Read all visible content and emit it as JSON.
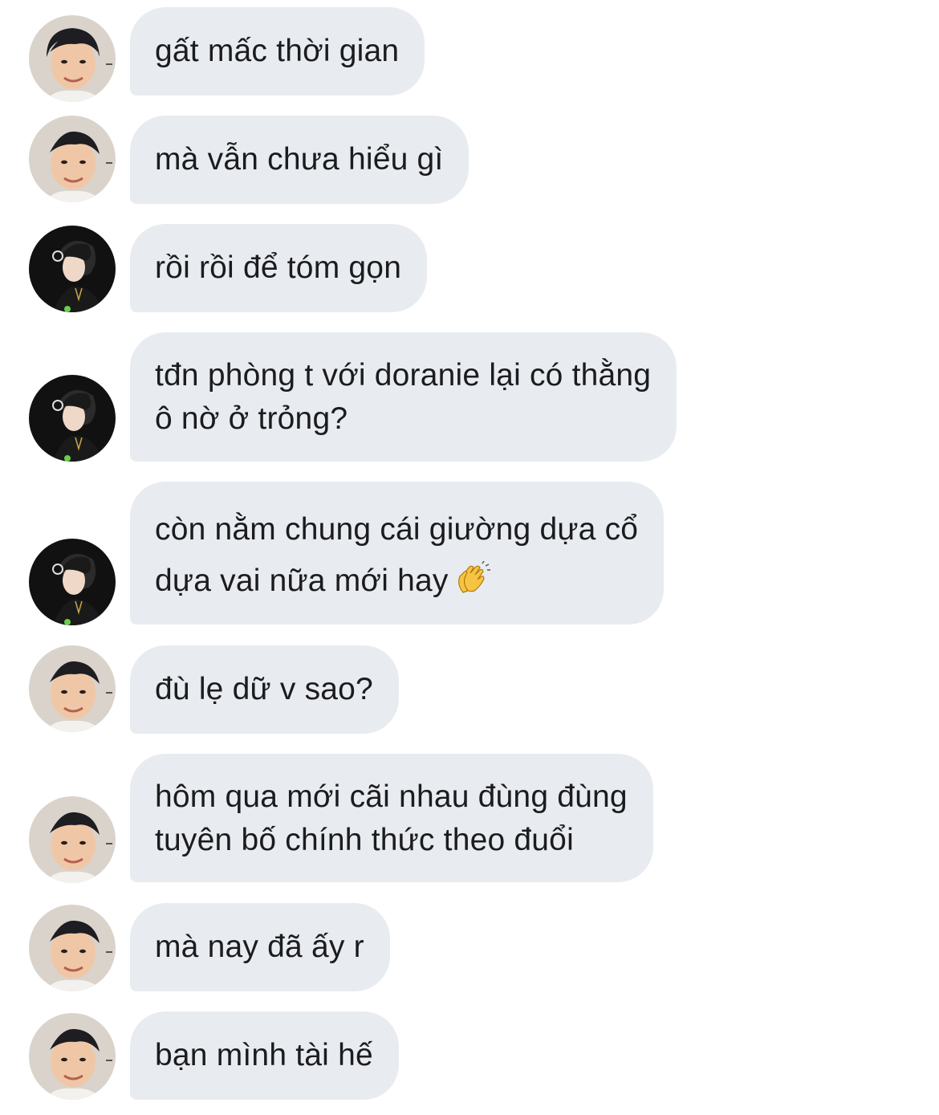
{
  "chat": {
    "messages": [
      {
        "sender": "a",
        "lines": [
          "gất mấc thời gian"
        ]
      },
      {
        "sender": "a",
        "lines": [
          "mà vẫn chưa hiểu gì"
        ]
      },
      {
        "sender": "b",
        "lines": [
          "rồi rồi để tóm gọn"
        ]
      },
      {
        "sender": "b",
        "lines": [
          "tđn phòng t với doranie lại có thằng",
          "ô nờ ở trỏng?"
        ]
      },
      {
        "sender": "b",
        "lines": [
          "còn nằm chung cái giường dựa cổ",
          "dựa vai nữa mới hay"
        ],
        "emoji": "clapping-hands"
      },
      {
        "sender": "a",
        "lines": [
          "đù lẹ dữ v sao?"
        ]
      },
      {
        "sender": "a",
        "lines": [
          "hôm qua mới cãi nhau đùng đùng",
          "tuyên bố chính thức theo đuổi"
        ]
      },
      {
        "sender": "a",
        "lines": [
          "mà nay đã ấy r"
        ]
      },
      {
        "sender": "a",
        "lines": [
          "bạn mình tài hế"
        ]
      }
    ]
  },
  "colors": {
    "bubble": "#e8ecf0",
    "text": "#1c1c1e",
    "avatar_a_bg": "#dcd6cf",
    "avatar_b_bg": "#111111"
  }
}
